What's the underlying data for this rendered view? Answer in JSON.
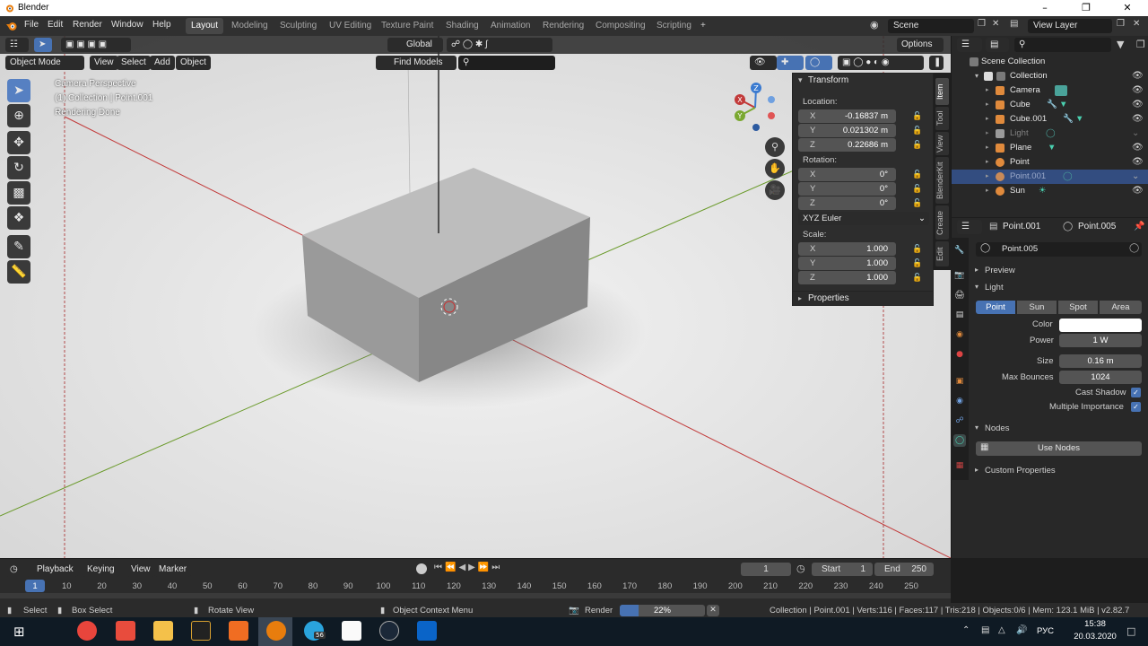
{
  "window": {
    "title": "Blender"
  },
  "menu": [
    "File",
    "Edit",
    "Render",
    "Window",
    "Help"
  ],
  "workspaces": [
    "Layout",
    "Modeling",
    "Sculpting",
    "UV Editing",
    "Texture Paint",
    "Shading",
    "Animation",
    "Rendering",
    "Compositing",
    "Scripting"
  ],
  "active_workspace": "Layout",
  "add_workspace": "+",
  "scene": "Scene",
  "view_layer": "View Layer",
  "viewport": {
    "orientation": "Global",
    "options": "Options",
    "mode": "Object Mode",
    "header_menus": [
      "View",
      "Select",
      "Add",
      "Object"
    ],
    "find_models": "Find Models",
    "overlay_lines": [
      "Camera Perspective",
      "(1) Collection | Point.001",
      "Rendering Done"
    ],
    "gizmo_axes": [
      "X",
      "Y",
      "Z"
    ]
  },
  "npanel": {
    "transform_title": "Transform",
    "location_label": "Location:",
    "location": [
      {
        "axis": "X",
        "value": "-0.16837 m"
      },
      {
        "axis": "Y",
        "value": "0.021302 m"
      },
      {
        "axis": "Z",
        "value": "0.22686 m"
      }
    ],
    "rotation_label": "Rotation:",
    "rotation": [
      {
        "axis": "X",
        "value": "0°"
      },
      {
        "axis": "Y",
        "value": "0°"
      },
      {
        "axis": "Z",
        "value": "0°"
      }
    ],
    "rotation_mode": "XYZ Euler",
    "scale_label": "Scale:",
    "scale": [
      {
        "axis": "X",
        "value": "1.000"
      },
      {
        "axis": "Y",
        "value": "1.000"
      },
      {
        "axis": "Z",
        "value": "1.000"
      }
    ],
    "properties_title": "Properties",
    "tabs": [
      "Item",
      "Tool",
      "View",
      "BlenderKit",
      "Create",
      "Edit"
    ]
  },
  "outliner": {
    "root": "Scene Collection",
    "collection": "Collection",
    "items": [
      {
        "name": "Camera",
        "color": "#e08a3c"
      },
      {
        "name": "Cube",
        "color": "#e08a3c"
      },
      {
        "name": "Cube.001",
        "color": "#e08a3c"
      },
      {
        "name": "Light",
        "color": "#9a9a9a"
      },
      {
        "name": "Plane",
        "color": "#e08a3c"
      },
      {
        "name": "Point",
        "color": "#e08a3c"
      },
      {
        "name": "Point.001",
        "color": "#e08a3c"
      },
      {
        "name": "Sun",
        "color": "#e08a3c"
      }
    ]
  },
  "properties": {
    "object_name": "Point.001",
    "data_name": "Point.005",
    "datablock": "Point.005",
    "preview": "Preview",
    "light_section": "Light",
    "light_types": [
      "Point",
      "Sun",
      "Spot",
      "Area"
    ],
    "active_light_type": "Point",
    "color_label": "Color",
    "power_label": "Power",
    "power": "1 W",
    "size_label": "Size",
    "size": "0.16 m",
    "bounces_label": "Max Bounces",
    "bounces": "1024",
    "cast_shadow": "Cast Shadow",
    "multiple_importance": "Multiple Importance",
    "nodes_section": "Nodes",
    "use_nodes": "Use Nodes",
    "custom_properties": "Custom Properties"
  },
  "timeline": {
    "menus": [
      "Playback",
      "Keying",
      "View",
      "Marker"
    ],
    "current_frame": "1",
    "start_label": "Start",
    "start": "1",
    "end_label": "End",
    "end": "250",
    "ruler": [
      "1",
      "10",
      "20",
      "30",
      "40",
      "50",
      "60",
      "70",
      "80",
      "90",
      "100",
      "110",
      "120",
      "130",
      "140",
      "150",
      "160",
      "170",
      "180",
      "190",
      "200",
      "210",
      "220",
      "230",
      "240",
      "250"
    ]
  },
  "status": {
    "select": "Select",
    "box_select": "Box Select",
    "rotate_view": "Rotate View",
    "context_menu": "Object Context Menu",
    "render_label": "Render",
    "render_progress": 0.22,
    "render_percent": "22%",
    "stats": "Collection | Point.001 | Verts:116 | Faces:117 | Tris:218 | Objects:0/6 | Mem: 123.1 MiB | v2.82.7"
  },
  "taskbar": {
    "language": "РУС",
    "time": "15:38",
    "date": "20.03.2020",
    "badge": "56"
  },
  "colors": {
    "accent": "#4772b3",
    "selected_row": "#334d80",
    "x_axis": "#c23a3a",
    "y_axis": "#6a9a2a"
  }
}
